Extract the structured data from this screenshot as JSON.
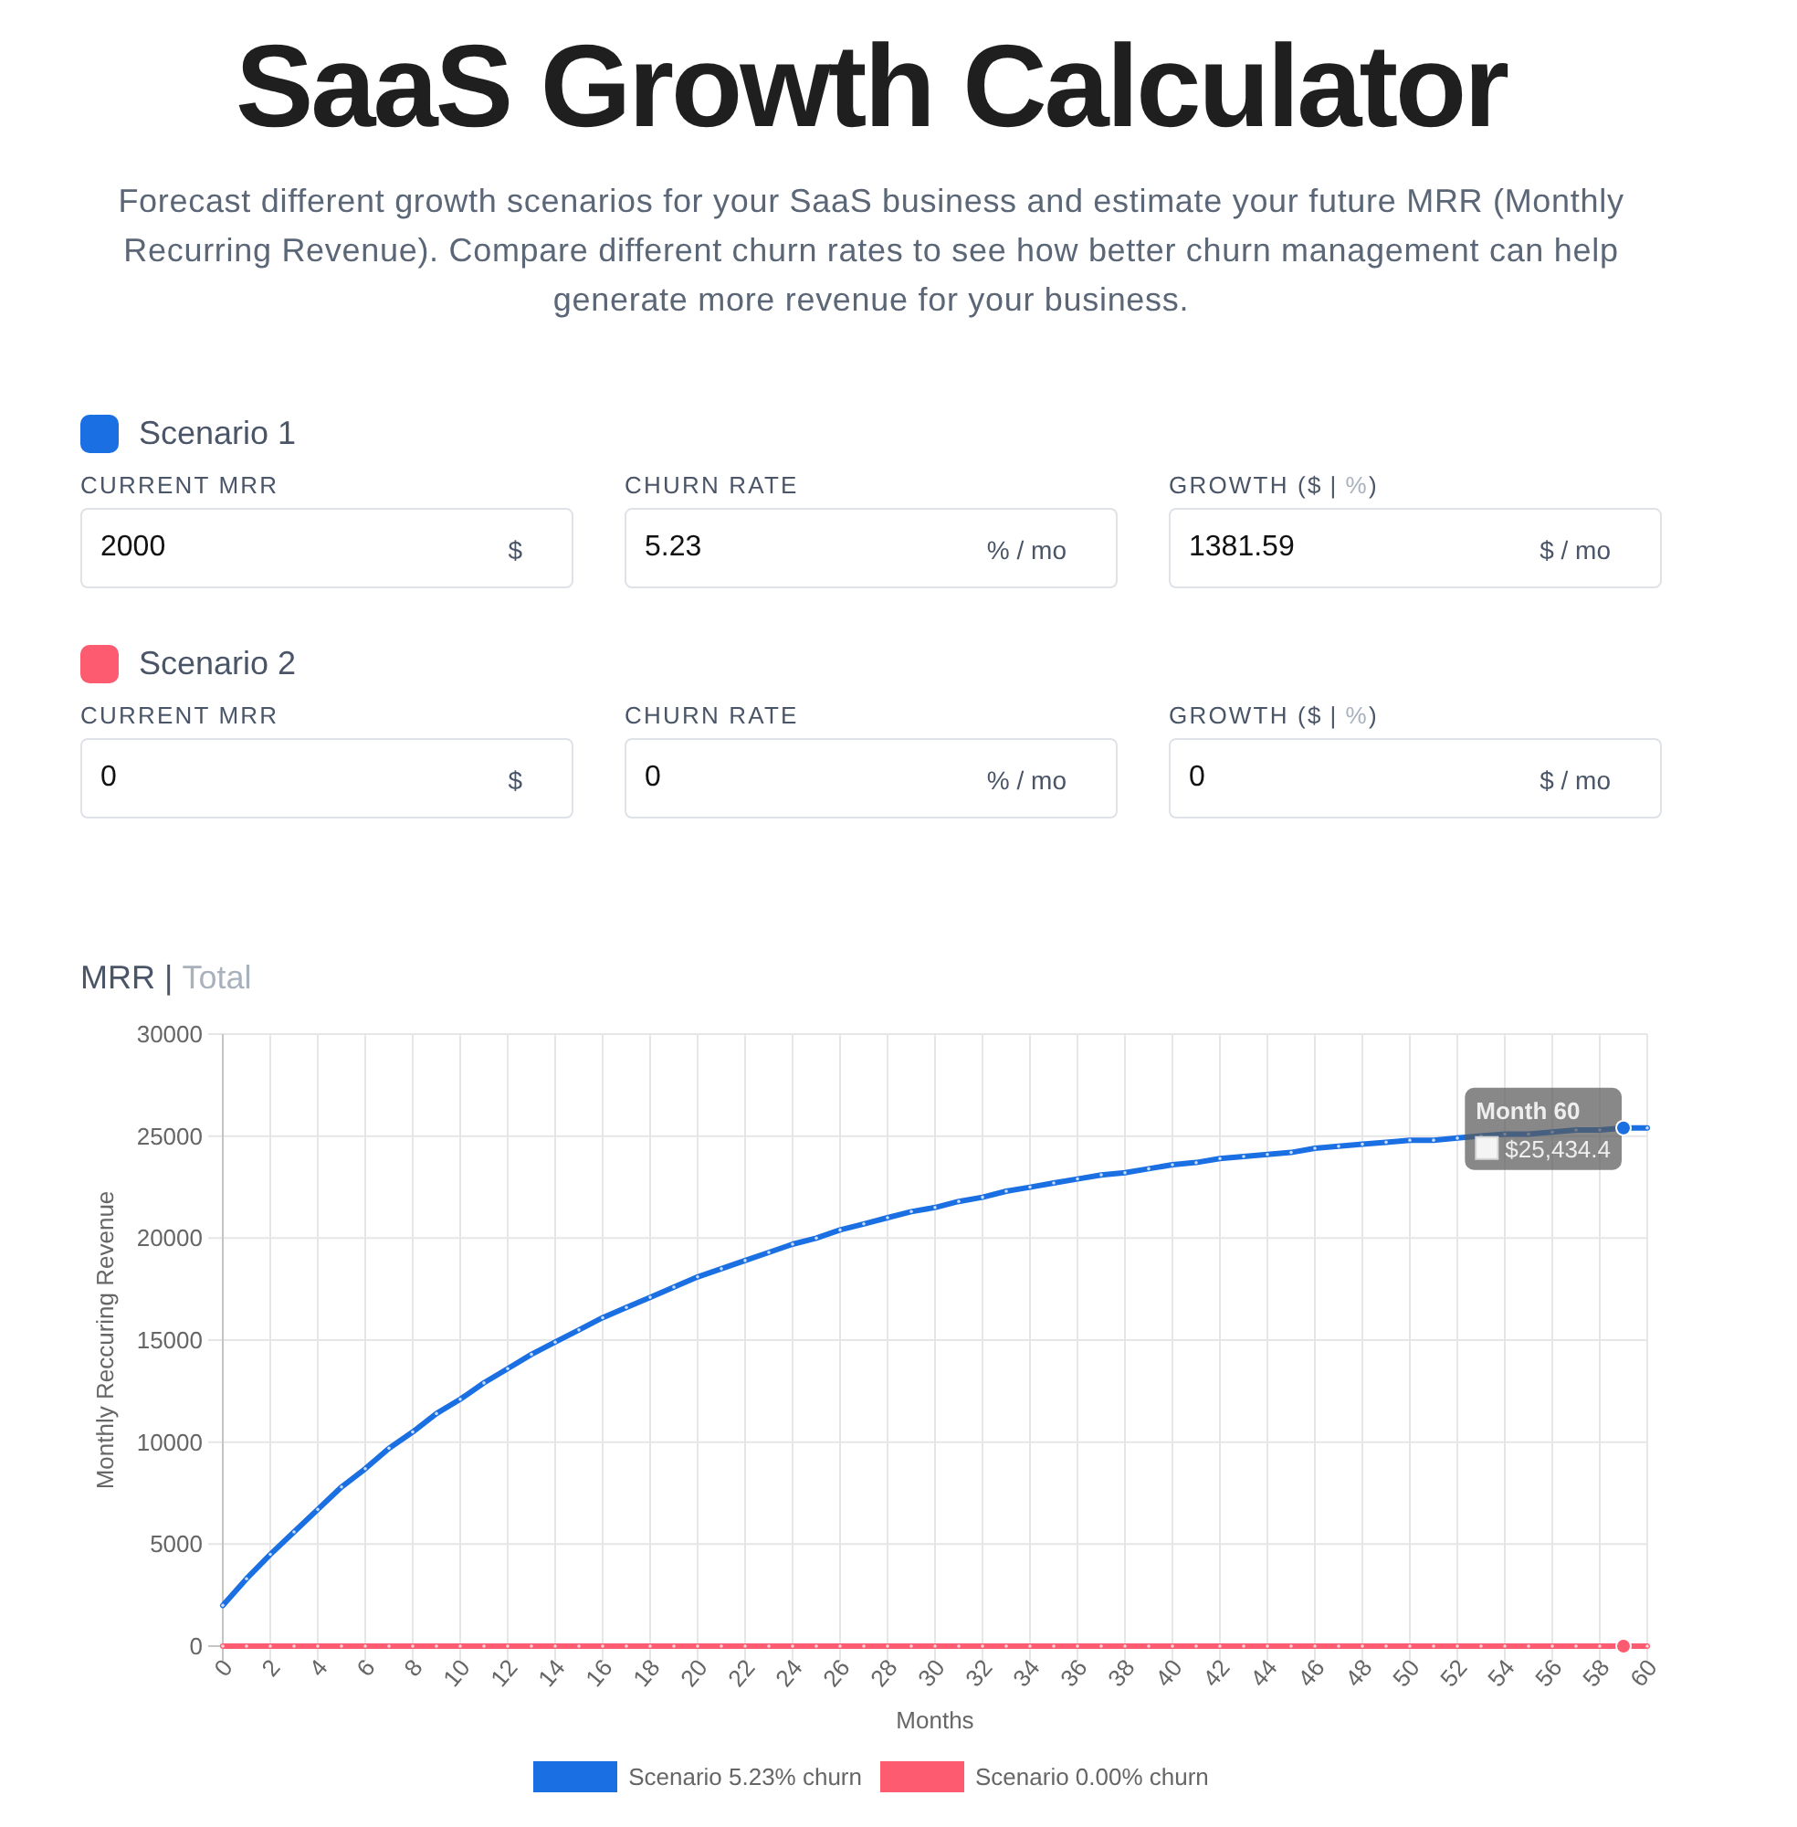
{
  "title": "SaaS Growth Calculator",
  "intro": "Forecast different growth scenarios for your SaaS business and estimate your future MRR (Monthly Recurring Revenue). Compare different churn rates to see how better churn management can help generate more revenue for your business.",
  "scenarios": [
    {
      "name": "Scenario 1",
      "color": "#1a6fe3",
      "fields": [
        {
          "kind": "plain",
          "label": "CURRENT MRR",
          "value": "2000",
          "unit": "$"
        },
        {
          "kind": "plain",
          "label": "CHURN RATE",
          "value": "5.23",
          "unit": "% / mo"
        },
        {
          "kind": "toggle",
          "label": "GROWTH (",
          "modes": [
            {
              "label": "$",
              "selected": true
            },
            {
              "label": "%",
              "selected": false
            }
          ],
          "separator": "|",
          "label_end": ")",
          "value": "1381.59",
          "unit": "$ / mo"
        }
      ]
    },
    {
      "name": "Scenario 2",
      "color": "#fd5b6f",
      "fields": [
        {
          "kind": "plain",
          "label": "CURRENT MRR",
          "value": "0",
          "unit": "$"
        },
        {
          "kind": "plain",
          "label": "CHURN RATE",
          "value": "0",
          "unit": "% / mo"
        },
        {
          "kind": "toggle",
          "label": "GROWTH (",
          "modes": [
            {
              "label": "$",
              "selected": true
            },
            {
              "label": "%",
              "selected": false
            }
          ],
          "separator": "|",
          "label_end": ")",
          "value": "0",
          "unit": "$ / mo"
        }
      ]
    }
  ],
  "chart": {
    "views": [
      {
        "label": "MRR",
        "selected": true
      },
      {
        "label": "Total",
        "selected": false
      }
    ],
    "view_separator": "|",
    "tooltip_title": "Month 60",
    "chart_data": {
      "type": "line",
      "xlabel": "Months",
      "ylabel": "Monthly Reccuring Revenue",
      "x": [
        0,
        1,
        2,
        3,
        4,
        5,
        6,
        7,
        8,
        9,
        10,
        11,
        12,
        13,
        14,
        15,
        16,
        17,
        18,
        19,
        20,
        21,
        22,
        23,
        24,
        25,
        26,
        27,
        28,
        29,
        30,
        31,
        32,
        33,
        34,
        35,
        36,
        37,
        38,
        39,
        40,
        41,
        42,
        43,
        44,
        45,
        46,
        47,
        48,
        49,
        50,
        51,
        52,
        53,
        54,
        55,
        56,
        57,
        58,
        59,
        60
      ],
      "series": [
        {
          "name": "Scenario 5.23% churn",
          "color": "#1a6fe3",
          "values": [
            2000,
            3300,
            4500,
            5600,
            6700,
            7800,
            8700,
            9700,
            10500,
            11400,
            12100,
            12900,
            13600,
            14300,
            14900,
            15500,
            16100,
            16600,
            17100,
            17600,
            18100,
            18500,
            18900,
            19300,
            19700,
            20000,
            20400,
            20700,
            21000,
            21300,
            21500,
            21800,
            22000,
            22300,
            22500,
            22700,
            22900,
            23100,
            23200,
            23400,
            23600,
            23700,
            23900,
            24000,
            24100,
            24200,
            24400,
            24500,
            24600,
            24700,
            24800,
            24800,
            24900,
            25000,
            25100,
            25100,
            25200,
            25300,
            25300,
            25400,
            25400
          ]
        },
        {
          "name": "Scenario 0.00% churn",
          "color": "#fd5b6f",
          "values": [
            0,
            0,
            0,
            0,
            0,
            0,
            0,
            0,
            0,
            0,
            0,
            0,
            0,
            0,
            0,
            0,
            0,
            0,
            0,
            0,
            0,
            0,
            0,
            0,
            0,
            0,
            0,
            0,
            0,
            0,
            0,
            0,
            0,
            0,
            0,
            0,
            0,
            0,
            0,
            0,
            0,
            0,
            0,
            0,
            0,
            0,
            0,
            0,
            0,
            0,
            0,
            0,
            0,
            0,
            0,
            0,
            0,
            0,
            0,
            0,
            0
          ]
        }
      ],
      "xlim": [
        0,
        60
      ],
      "ylim": [
        0,
        30000
      ],
      "xticks": [
        0,
        2,
        4,
        6,
        8,
        10,
        12,
        14,
        16,
        18,
        20,
        22,
        24,
        26,
        28,
        30,
        32,
        34,
        36,
        38,
        40,
        42,
        44,
        46,
        48,
        50,
        52,
        54,
        56,
        58,
        60
      ],
      "yticks": [
        0,
        5000,
        10000,
        15000,
        20000,
        25000,
        30000
      ],
      "grid": true,
      "annotations": [
        {
          "x": 59,
          "y": 25400,
          "text": "$25,434.4"
        }
      ]
    }
  }
}
